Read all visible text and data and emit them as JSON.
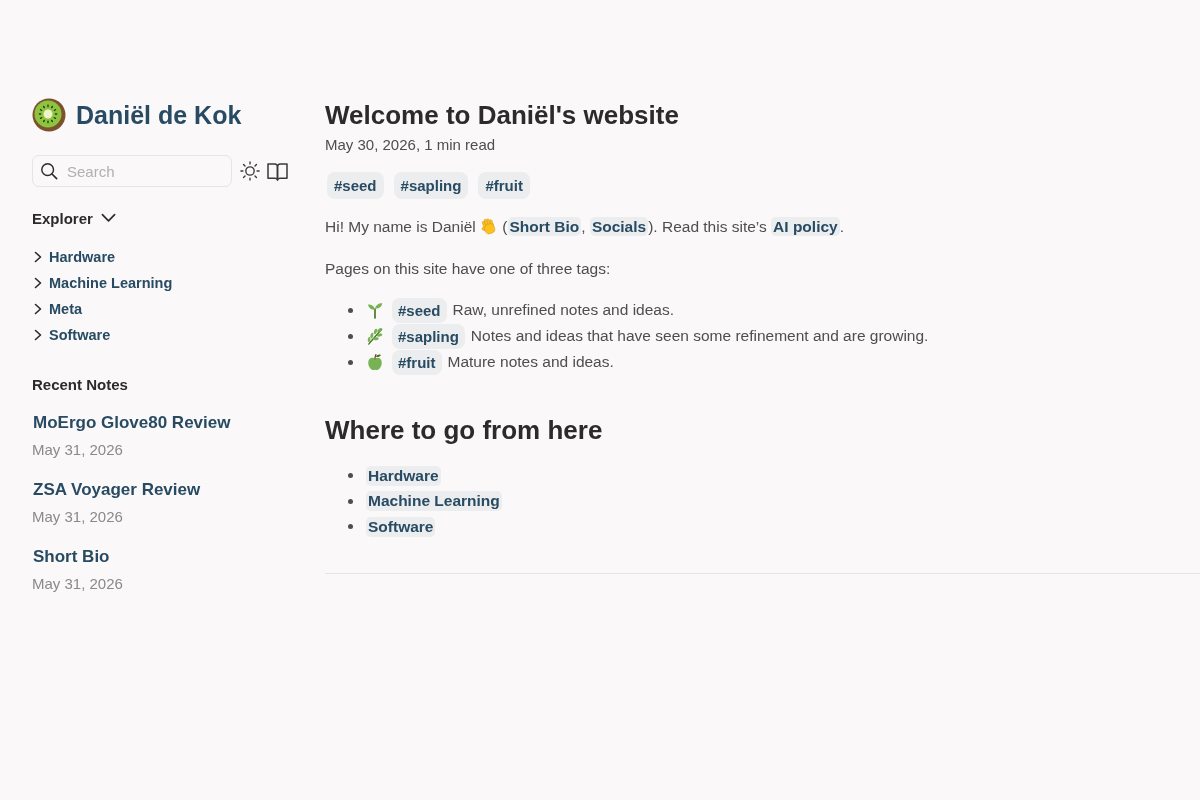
{
  "sidebar": {
    "site_title": "Daniël de Kok",
    "search": {
      "placeholder": "Search"
    },
    "explorer": {
      "title": "Explorer",
      "expanded": true,
      "items": [
        {
          "label": "Hardware",
          "expanded": false
        },
        {
          "label": "Machine Learning",
          "expanded": false
        },
        {
          "label": "Meta",
          "expanded": false
        },
        {
          "label": "Software",
          "expanded": false
        }
      ]
    },
    "recent_notes": {
      "title": "Recent Notes",
      "items": [
        {
          "title": "MoErgo Glove80 Review",
          "date": "May 31, 2026"
        },
        {
          "title": "ZSA Voyager Review",
          "date": "May 31, 2026"
        },
        {
          "title": "Short Bio",
          "date": "May 31, 2026"
        }
      ]
    }
  },
  "article": {
    "title": "Welcome to Daniël's website",
    "meta": "May 30, 2026, 1 min read",
    "tags": [
      "#seed",
      "#sapling",
      "#fruit"
    ],
    "intro": [
      {
        "kind": "text",
        "text": "Hi! My name is Daniël "
      },
      {
        "kind": "icon"
      },
      {
        "kind": "text",
        "text": " ("
      },
      {
        "kind": "link",
        "text": "Short Bio"
      },
      {
        "kind": "text",
        "text": ", "
      },
      {
        "kind": "link",
        "text": "Socials"
      },
      {
        "kind": "text",
        "text": "). Read this site’s "
      },
      {
        "kind": "link",
        "text": "AI policy"
      },
      {
        "kind": "text",
        "text": "."
      }
    ],
    "tags_intro": "Pages on this site have one of three tags:",
    "tag_list": [
      {
        "tag": "#seed",
        "description": "Raw, unrefined notes and ideas."
      },
      {
        "tag": "#sapling",
        "description": "Notes and ideas that have seen some refinement and are growing."
      },
      {
        "tag": "#fruit",
        "description": "Mature notes and ideas."
      }
    ],
    "section_title": "Where to go from here",
    "links": [
      "Hardware",
      "Machine Learning",
      "Software"
    ]
  }
}
